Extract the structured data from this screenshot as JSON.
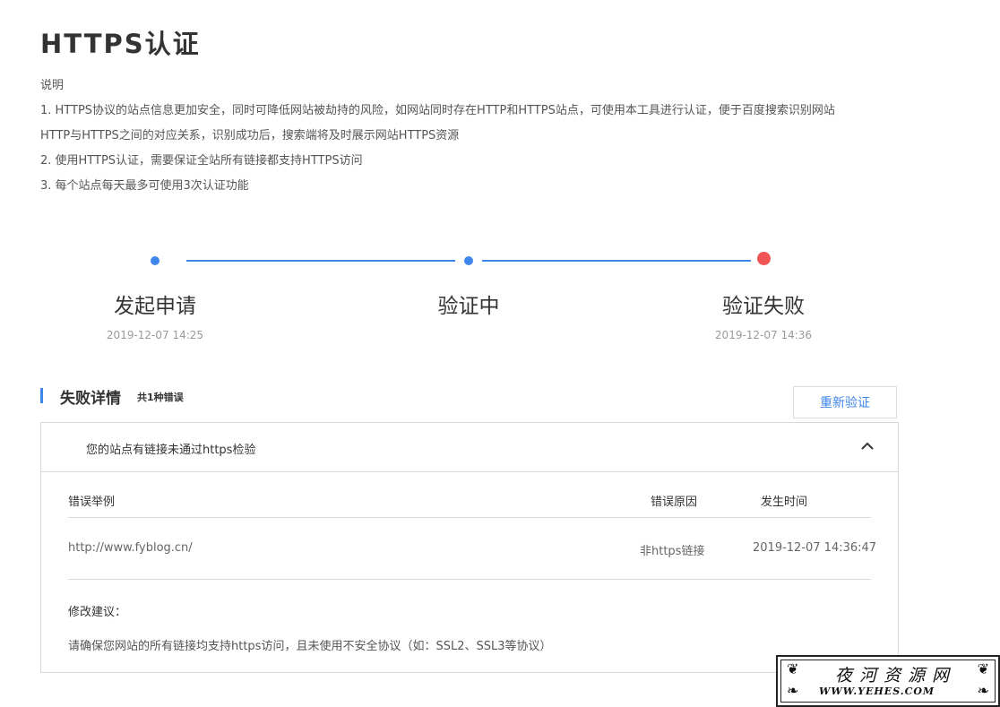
{
  "page": {
    "title": "HTTPS认证"
  },
  "description": {
    "heading": "说明",
    "line1": "1. HTTPS协议的站点信息更加安全，同时可降低网站被劫持的风险，如网站同时存在HTTP和HTTPS站点，可使用本工具进行认证，便于百度搜索识别网站",
    "line1b": "HTTP与HTTPS之间的对应关系，识别成功后，搜索端将及时展示网站HTTPS资源",
    "line2": "2. 使用HTTPS认证，需要保证全站所有链接都支持HTTPS访问",
    "line3": "3. 每个站点每天最多可使用3次认证功能"
  },
  "steps": [
    {
      "label": "发起申请",
      "time": "2019-12-07 14:25",
      "status": "done",
      "color": "#3f86ea"
    },
    {
      "label": "验证中",
      "time": "",
      "status": "done",
      "color": "#3f86ea"
    },
    {
      "label": "验证失败",
      "time": "2019-12-07 14:36",
      "status": "failed",
      "color": "#f05454"
    }
  ],
  "fail_section": {
    "title": "失败详情",
    "count": "共1种错误",
    "retry_label": "重新验证",
    "panel_title": "您的站点有链接未通过https检验",
    "columns": {
      "example": "错误举例",
      "reason": "错误原因",
      "time": "发生时间"
    },
    "rows": [
      {
        "example": "http://www.fyblog.cn/",
        "reason": "非https链接",
        "time": "2019-12-07 14:36:47"
      }
    ],
    "suggestion_title": "修改建议：",
    "suggestion_text": "请确保您网站的所有链接均支持https访问，且未使用不安全协议（如：SSL2、SSL3等协议）"
  },
  "watermark": {
    "cn": "夜河资源网",
    "en": "WWW.YEHES.COM"
  },
  "colors": {
    "accent": "#3f86ea",
    "error": "#f05454"
  }
}
